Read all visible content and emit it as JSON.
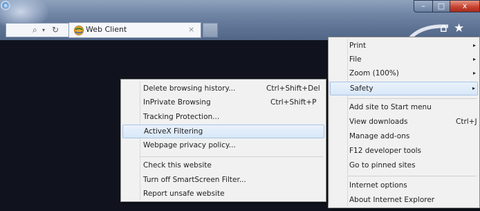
{
  "window": {
    "minimize_glyph": "–",
    "maximize_glyph": "□",
    "close_glyph": "x"
  },
  "addressbar": {
    "search_glyph": "⌕",
    "dropdown_glyph": "▾",
    "refresh_glyph": "↻"
  },
  "tab": {
    "title": "Web Client",
    "close_glyph": "×"
  },
  "toolbar": {
    "home_glyph": "⌂",
    "star_glyph": "★"
  },
  "tools_menu": {
    "items": [
      {
        "label": "Print",
        "has_submenu": true
      },
      {
        "label": "File",
        "has_submenu": true
      },
      {
        "label": "Zoom (100%)",
        "has_submenu": true
      },
      {
        "label": "Safety",
        "has_submenu": true,
        "highlighted": true
      },
      {
        "label": "Add site to Start menu"
      },
      {
        "label": "View downloads",
        "shortcut": "Ctrl+J"
      },
      {
        "label": "Manage add-ons"
      },
      {
        "label": "F12 developer tools"
      },
      {
        "label": "Go to pinned sites"
      },
      {
        "label": "Internet options"
      },
      {
        "label": "About Internet Explorer"
      }
    ],
    "submenu_arrow": "▸"
  },
  "safety_menu": {
    "items": [
      {
        "label": "Delete browsing history...",
        "shortcut": "Ctrl+Shift+Del"
      },
      {
        "label": "InPrivate Browsing",
        "shortcut": "Ctrl+Shift+P"
      },
      {
        "label": "Tracking Protection..."
      },
      {
        "label": "ActiveX Filtering",
        "highlighted": true
      },
      {
        "label": "Webpage privacy policy..."
      },
      {
        "label": "Check this website"
      },
      {
        "label": "Turn off SmartScreen Filter..."
      },
      {
        "label": "Report unsafe website"
      }
    ]
  },
  "colors": {
    "titlebar": "#6d81a1",
    "content_background": "#10131d",
    "menu_background": "#f1f1f1",
    "highlight": "#d8e7f8",
    "close_button": "#c84432"
  }
}
